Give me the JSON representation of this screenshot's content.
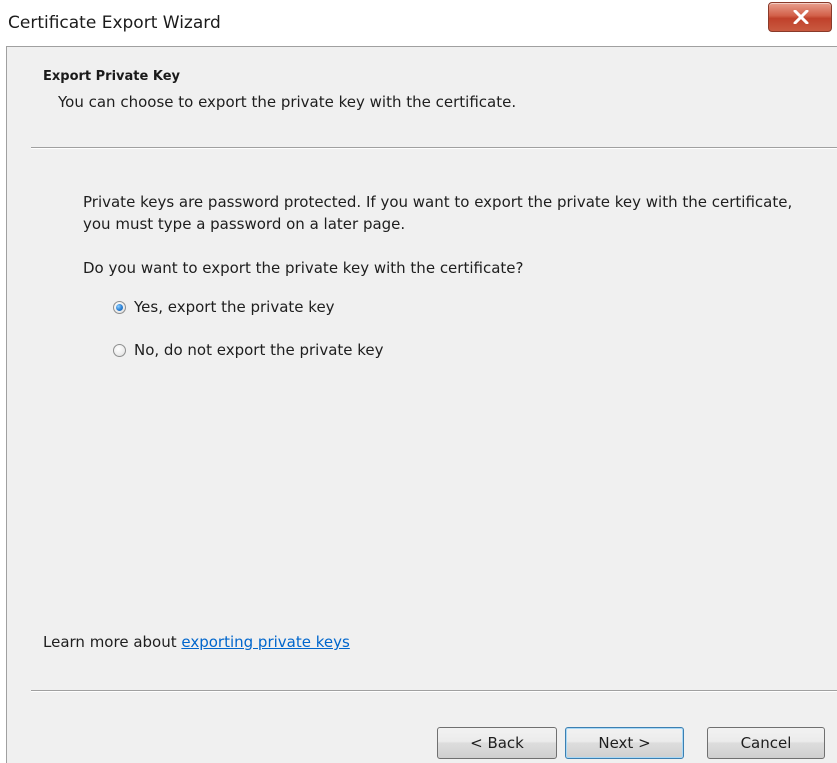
{
  "window": {
    "title": "Certificate Export Wizard",
    "close_glyph": "X"
  },
  "header": {
    "title": "Export Private Key",
    "subtitle": "You can choose to export the private key with the certificate."
  },
  "content": {
    "description": "Private keys are password protected. If you want to export the private key with the certificate, you must type a password on a later page.",
    "question": "Do you want to export the private key with the certificate?",
    "options": [
      {
        "label": "Yes, export the private key",
        "selected": true
      },
      {
        "label": "No, do not export the private key",
        "selected": false
      }
    ]
  },
  "footer": {
    "learn_more_prefix": "Learn more about ",
    "learn_more_link": "exporting private keys"
  },
  "buttons": {
    "back": "< Back",
    "next": "Next >",
    "cancel": "Cancel"
  },
  "colors": {
    "link": "#0066cc",
    "close_button": "#c0412b",
    "dialog_background": "#f0f0f0"
  }
}
